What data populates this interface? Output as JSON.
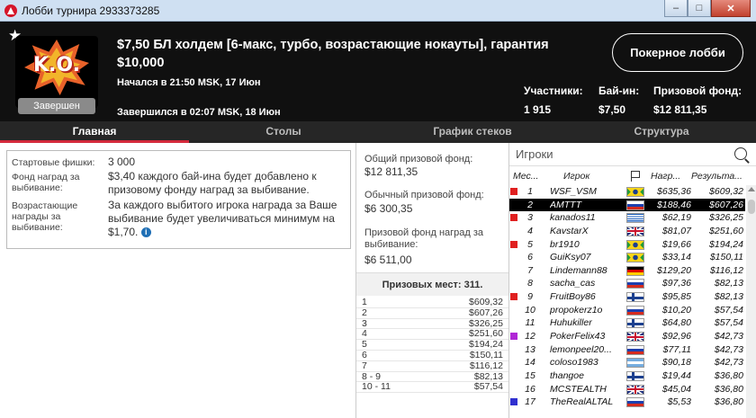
{
  "window": {
    "title": "Лобби турнира 2933373285",
    "minimize": "‒",
    "maximize": "□",
    "close": "✕"
  },
  "header": {
    "badge_text": "K.O.",
    "status": "Завершен",
    "tournament_name": "$7,50 БЛ холдем [6-макс, турбо, возрастающие нокауты], гарантия $10,000",
    "started": "Начался в 21:50 MSK, 17 Июн",
    "finished": "Завершился в 02:07 MSK, 18 Июн",
    "lobby_button": "Покерное лобби",
    "stats": {
      "players_label": "Участники:",
      "players_value": "1 915",
      "buyin_label": "Бай-ин:",
      "buyin_value": "$7,50",
      "prize_label": "Призовой фонд:",
      "prize_value": "$12 811,35"
    }
  },
  "tabs": [
    "Главная",
    "Столы",
    "График стеков",
    "Структура"
  ],
  "info": {
    "chips_label": "Стартовые фишки:",
    "chips_value": "3 000",
    "bounty_fund_label": "Фонд наград за выбивание:",
    "bounty_fund_value": "$3,40 каждого бай-ина будет добавлено к призовому фонду наград за выбивание.",
    "progressive_label": "Возрастающие награды за выбивание:",
    "progressive_value": "За каждого выбитого игрока награда за Ваше выбивание будет увеличиваться минимум на $1,70."
  },
  "prize": {
    "total_label": "Общий призовой фонд:",
    "total_value": "$12 811,35",
    "regular_label": "Обычный призовой фонд:",
    "regular_value": "$6 300,35",
    "bounty_label": "Призовой фонд наград за выбивание:",
    "bounty_value": "$6 511,00",
    "paid_places": "Призовых мест: 311.",
    "payouts": [
      {
        "place": "1",
        "amount": "$609,32"
      },
      {
        "place": "2",
        "amount": "$607,26"
      },
      {
        "place": "3",
        "amount": "$326,25"
      },
      {
        "place": "4",
        "amount": "$251,60"
      },
      {
        "place": "5",
        "amount": "$194,24"
      },
      {
        "place": "6",
        "amount": "$150,11"
      },
      {
        "place": "7",
        "amount": "$116,12"
      },
      {
        "place": "8 - 9",
        "amount": "$82,13"
      },
      {
        "place": "10 - 11",
        "amount": "$57,54"
      }
    ]
  },
  "players": {
    "search_placeholder": "Игроки",
    "columns": {
      "place": "Мес...",
      "player": "Игрок",
      "bounty": "Нагр...",
      "result": "Результа..."
    },
    "rows": [
      {
        "mark": "#e02020",
        "rank": "1",
        "name": "WSF_VSM",
        "flag": "brazil",
        "bounty": "$635,36",
        "result": "$609,32"
      },
      {
        "mark": "",
        "rank": "2",
        "name": "AMTTT",
        "flag": "russia",
        "bounty": "$188,46",
        "result": "$607,26",
        "selected": true
      },
      {
        "mark": "#e02020",
        "rank": "3",
        "name": "kanados11",
        "flag": "greece",
        "bounty": "$62,19",
        "result": "$326,25"
      },
      {
        "mark": "",
        "rank": "4",
        "name": "KavstarX",
        "flag": "uk",
        "bounty": "$81,07",
        "result": "$251,60"
      },
      {
        "mark": "#e02020",
        "rank": "5",
        "name": "br1910",
        "flag": "brazil",
        "bounty": "$19,66",
        "result": "$194,24"
      },
      {
        "mark": "",
        "rank": "6",
        "name": "GuiKsy07",
        "flag": "brazil",
        "bounty": "$33,14",
        "result": "$150,11"
      },
      {
        "mark": "",
        "rank": "7",
        "name": "Lindemann88",
        "flag": "germany",
        "bounty": "$129,20",
        "result": "$116,12"
      },
      {
        "mark": "",
        "rank": "8",
        "name": "sacha_cas",
        "flag": "russia",
        "bounty": "$97,36",
        "result": "$82,13"
      },
      {
        "mark": "#e02020",
        "rank": "9",
        "name": "FruitBoy86",
        "flag": "finland",
        "bounty": "$95,85",
        "result": "$82,13"
      },
      {
        "mark": "",
        "rank": "10",
        "name": "propokerz1o",
        "flag": "russia",
        "bounty": "$10,20",
        "result": "$57,54"
      },
      {
        "mark": "",
        "rank": "11",
        "name": "Huhukiller",
        "flag": "finland",
        "bounty": "$64,80",
        "result": "$57,54"
      },
      {
        "mark": "#b026d6",
        "rank": "12",
        "name": "PokerFelix43",
        "flag": "uk",
        "bounty": "$92,96",
        "result": "$42,73"
      },
      {
        "mark": "",
        "rank": "13",
        "name": "lemonpeel20...",
        "flag": "russia",
        "bounty": "$77,11",
        "result": "$42,73"
      },
      {
        "mark": "",
        "rank": "14",
        "name": "coloso1983",
        "flag": "argentina",
        "bounty": "$90,18",
        "result": "$42,73"
      },
      {
        "mark": "",
        "rank": "15",
        "name": "thangoe",
        "flag": "finland",
        "bounty": "$19,44",
        "result": "$36,80"
      },
      {
        "mark": "",
        "rank": "16",
        "name": "MCSTEALTH",
        "flag": "uk",
        "bounty": "$45,04",
        "result": "$36,80"
      },
      {
        "mark": "#3030d0",
        "rank": "17",
        "name": "TheRealALTAL",
        "flag": "russia",
        "bounty": "$5,53",
        "result": "$36,80"
      }
    ]
  }
}
